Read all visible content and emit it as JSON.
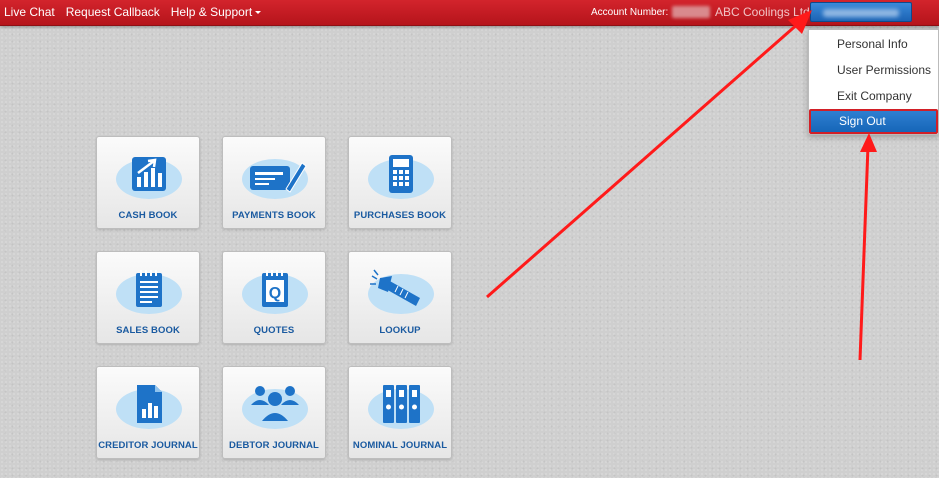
{
  "topbar": {
    "nav": [
      {
        "label": "Live Chat"
      },
      {
        "label": "Request Callback"
      },
      {
        "label": "Help & Support"
      }
    ],
    "account_label": "Account Number:",
    "company": "ABC Coolings Ltd"
  },
  "user_menu": {
    "items": [
      {
        "label": "Personal Info"
      },
      {
        "label": "User Permissions"
      },
      {
        "label": "Exit Company"
      },
      {
        "label": "Sign Out"
      }
    ]
  },
  "tiles": [
    {
      "label": "CASH BOOK",
      "icon": "chart-up-icon"
    },
    {
      "label": "PAYMENTS BOOK",
      "icon": "cheque-pen-icon"
    },
    {
      "label": "PURCHASES BOOK",
      "icon": "calculator-icon"
    },
    {
      "label": "SALES BOOK",
      "icon": "notepad-icon"
    },
    {
      "label": "QUOTES",
      "icon": "quote-notepad-icon"
    },
    {
      "label": "LOOKUP",
      "icon": "flashlight-icon"
    },
    {
      "label": "CREDITOR JOURNAL",
      "icon": "document-chart-icon"
    },
    {
      "label": "DEBTOR JOURNAL",
      "icon": "people-group-icon"
    },
    {
      "label": "NOMINAL JOURNAL",
      "icon": "binders-icon"
    }
  ],
  "colors": {
    "topbar": "#c41c24",
    "accent": "#1c63b4",
    "annotation_arrow": "#ff1a1a"
  }
}
